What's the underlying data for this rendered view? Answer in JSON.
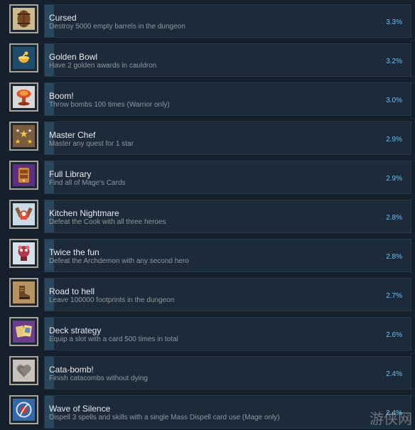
{
  "achievements": [
    {
      "title": "Cursed",
      "description": "Destroy 5000 empty barrels in the dungeon",
      "percent": "3.3%",
      "icon": "barrel-icon",
      "icon_bg": "#c9b68a"
    },
    {
      "title": "Golden Bowl",
      "description": "Have 2 golden awards in cauldron",
      "percent": "3.2%",
      "icon": "golden-bowl-icon",
      "icon_bg": "#2a5e80"
    },
    {
      "title": "Boom!",
      "description": "Throw bombs 100 times (Warrior only)",
      "percent": "3.0%",
      "icon": "explosion-icon",
      "icon_bg": "#cfcfcf"
    },
    {
      "title": "Master Chef",
      "description": "Master any quest for 1 star",
      "percent": "2.9%",
      "icon": "stars-icon",
      "icon_bg": "#8a6a4a"
    },
    {
      "title": "Full Library",
      "description": "Find all of Mage's Cards",
      "percent": "2.9%",
      "icon": "library-icon",
      "icon_bg": "#6a3a8a"
    },
    {
      "title": "Kitchen Nightmare",
      "description": "Defeat the Cook with all three heroes",
      "percent": "2.8%",
      "icon": "cook-icon",
      "icon_bg": "#8fb6c8"
    },
    {
      "title": "Twice the fun",
      "description": "Defeat the Archdemon with any second hero",
      "percent": "2.8%",
      "icon": "archdemon-icon",
      "icon_bg": "#9fb8c8"
    },
    {
      "title": "Road to hell",
      "description": "Leave 100000 footprints in the dungeon",
      "percent": "2.7%",
      "icon": "boot-icon",
      "icon_bg": "#b89a68"
    },
    {
      "title": "Deck strategy",
      "description": "Equip a slot with a card 500 times in total",
      "percent": "2.6%",
      "icon": "cards-icon",
      "icon_bg": "#7a4a9a"
    },
    {
      "title": "Cata-bomb!",
      "description": "Finish catacombs without dying",
      "percent": "2.4%",
      "icon": "heart-stone-icon",
      "icon_bg": "#b7b2ac"
    },
    {
      "title": "Wave of Silence",
      "description": "Dispell 3 spells and skills with a single Mass Dispell card use (Mage only)",
      "percent": "2.4%",
      "icon": "dispell-icon",
      "icon_bg": "#3e6fa8"
    }
  ],
  "watermark": "游侠网",
  "colors": {
    "background": "#16202d",
    "panel": "#1c2a39",
    "progress": "#2a475e",
    "title": "#e8ecf0",
    "description": "#8f98a0",
    "percent": "#66c0f4",
    "frame": "#a8a496"
  }
}
